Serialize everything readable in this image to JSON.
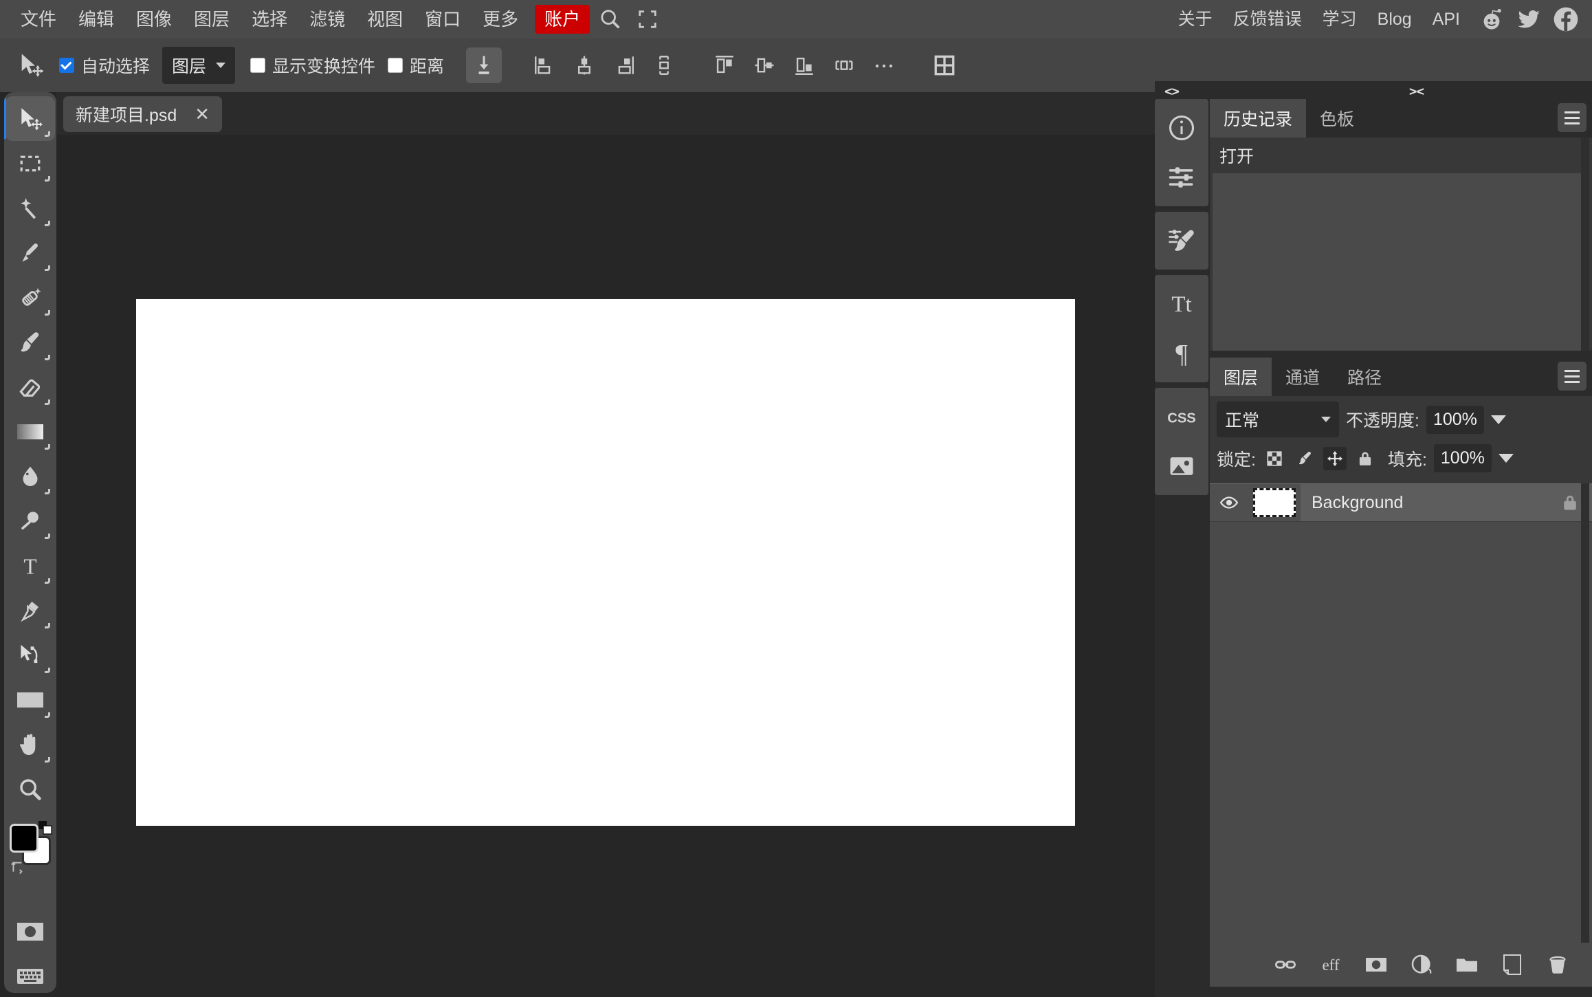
{
  "app": {
    "name": "Photopea Image Editor",
    "accent_red": "#cc0000",
    "accent_blue": "#1473e6",
    "bg": "#262626",
    "panel_bg": "#383838",
    "chrome_bg": "#4a4a4a"
  },
  "menubar": {
    "items": [
      {
        "label": "文件",
        "name": "menu-file"
      },
      {
        "label": "编辑",
        "name": "menu-edit"
      },
      {
        "label": "图像",
        "name": "menu-image"
      },
      {
        "label": "图层",
        "name": "menu-layer"
      },
      {
        "label": "选择",
        "name": "menu-select"
      },
      {
        "label": "滤镜",
        "name": "menu-filter"
      },
      {
        "label": "视图",
        "name": "menu-view"
      },
      {
        "label": "窗口",
        "name": "menu-window"
      },
      {
        "label": "更多",
        "name": "menu-more"
      }
    ],
    "account_label": "账户",
    "right_items": [
      {
        "label": "关于",
        "name": "menu-about"
      },
      {
        "label": "反馈错误",
        "name": "menu-report-bug"
      },
      {
        "label": "学习",
        "name": "menu-learn"
      },
      {
        "label": "Blog",
        "name": "menu-blog"
      },
      {
        "label": "API",
        "name": "menu-api"
      }
    ],
    "icons": [
      "search-icon",
      "fullscreen-icon",
      "reddit-icon",
      "twitter-icon",
      "facebook-icon"
    ]
  },
  "options_bar": {
    "tool_icon": "move-tool-icon",
    "auto_select": {
      "label": "自动选择",
      "checked": true
    },
    "scope_select": {
      "value": "图层"
    },
    "show_transform": {
      "label": "显示变换控件",
      "checked": false
    },
    "distance": {
      "label": "距离",
      "checked": false
    },
    "distribute_label": "…",
    "align_buttons": [
      "align-left-edges-icon",
      "align-horizontal-centers-icon",
      "align-right-edges-icon",
      "distribute-horizontal-icon",
      "align-top-edges-icon",
      "align-vertical-centers-icon",
      "align-bottom-edges-icon",
      "distribute-vertical-icon"
    ],
    "more_icon": "more-options-icon",
    "grid_icon": "arrange-documents-icon",
    "download_icon": "download-icon"
  },
  "toolbar": {
    "tools": [
      {
        "name": "move-tool",
        "icon": "move-tool-icon",
        "active": true
      },
      {
        "name": "rectangular-marquee-tool",
        "icon": "marquee-icon",
        "active": false
      },
      {
        "name": "magic-wand-tool",
        "icon": "magic-wand-icon",
        "active": false
      },
      {
        "name": "lasso-tool",
        "icon": "lasso-icon",
        "active": false
      },
      {
        "name": "spot-healing-tool",
        "icon": "healing-brush-icon",
        "active": false
      },
      {
        "name": "brush-tool",
        "icon": "brush-icon",
        "active": false
      },
      {
        "name": "eraser-tool",
        "icon": "eraser-icon",
        "active": false
      },
      {
        "name": "gradient-tool",
        "icon": "gradient-icon",
        "active": false
      },
      {
        "name": "blur-tool",
        "icon": "blur-droplet-icon",
        "active": false
      },
      {
        "name": "dodge-tool",
        "icon": "dodge-icon",
        "active": false
      },
      {
        "name": "type-tool",
        "icon": "type-icon",
        "active": false
      },
      {
        "name": "pen-tool",
        "icon": "pen-icon",
        "active": false
      },
      {
        "name": "path-select-tool",
        "icon": "path-select-icon",
        "active": false
      },
      {
        "name": "shape-tool",
        "icon": "rectangle-shape-icon",
        "active": false
      },
      {
        "name": "hand-tool",
        "icon": "hand-icon",
        "active": false
      },
      {
        "name": "zoom-tool",
        "icon": "zoom-magnifier-icon",
        "active": false
      }
    ],
    "color_swatches": {
      "foreground": "#000000",
      "background": "#ffffff",
      "swap_icon": "swap-colors-icon",
      "default_icon": "default-colors-icon"
    },
    "quick_mask_icon": "quick-mask-icon",
    "keyboard_icon": "keyboard-shortcuts-icon"
  },
  "document_tabs": [
    {
      "title": "新建项目.psd",
      "close": "✕",
      "active": true
    }
  ],
  "canvas": {
    "page_color": "#ffffff",
    "background": "#262626"
  },
  "dock": {
    "collapse_left_arrow": "<>",
    "collapse_right_arrow": "><",
    "rail": {
      "groups": [
        [
          {
            "name": "info-panel-icon"
          },
          {
            "name": "adjustments-panel-icon"
          }
        ],
        [
          {
            "name": "brush-settings-panel-icon"
          }
        ],
        [
          {
            "name": "character-panel-icon"
          },
          {
            "name": "paragraph-panel-icon"
          }
        ],
        [
          {
            "name": "css-panel-icon"
          },
          {
            "name": "image-panel-icon"
          }
        ]
      ]
    },
    "history_panel": {
      "tabs": [
        {
          "label": "历史记录",
          "active": true
        },
        {
          "label": "色板",
          "active": false
        }
      ],
      "items": [
        {
          "label": "打开"
        }
      ],
      "menu_icon": "panel-menu-icon"
    },
    "layers_panel": {
      "tabs": [
        {
          "label": "图层",
          "active": true
        },
        {
          "label": "通道",
          "active": false
        },
        {
          "label": "路径",
          "active": false
        }
      ],
      "menu_icon": "panel-menu-icon",
      "blend_mode": "正常",
      "opacity_label": "不透明度:",
      "opacity_value": "100%",
      "lock_label": "锁定:",
      "lock_icons": [
        {
          "name": "lock-transparent-pixels-icon",
          "selected": false
        },
        {
          "name": "lock-image-pixels-icon",
          "selected": false
        },
        {
          "name": "lock-position-icon",
          "selected": true
        },
        {
          "name": "lock-all-icon",
          "selected": false
        }
      ],
      "fill_label": "填充:",
      "fill_value": "100%",
      "layers": [
        {
          "name": "Background",
          "visible": true,
          "locked": true,
          "thumb_color": "#ffffff"
        }
      ],
      "bottom_buttons": [
        {
          "name": "link-layers-button",
          "icon": "link-icon"
        },
        {
          "name": "layer-styles-button",
          "icon": "fx-icon"
        },
        {
          "name": "add-layer-mask-button",
          "icon": "mask-icon"
        },
        {
          "name": "new-adjustment-layer-button",
          "icon": "half-circle-icon"
        },
        {
          "name": "new-group-button",
          "icon": "folder-icon"
        },
        {
          "name": "new-layer-button",
          "icon": "new-page-icon"
        },
        {
          "name": "delete-layer-button",
          "icon": "trash-icon"
        }
      ]
    }
  }
}
